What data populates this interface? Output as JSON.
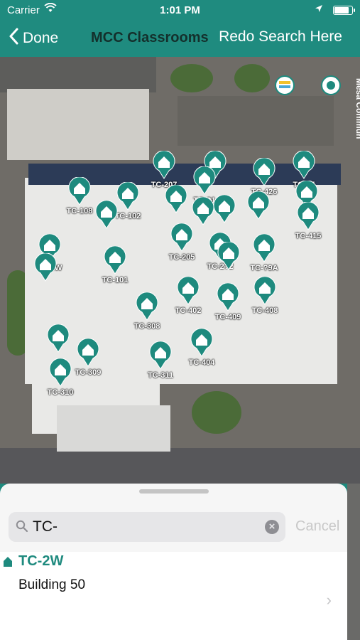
{
  "status": {
    "carrier": "Carrier",
    "time": "1:01 PM"
  },
  "nav": {
    "back_label": "Done",
    "title": "MCC Classrooms",
    "redo_label": "Redo Search Here"
  },
  "map": {
    "road_label": "Mesa Commun",
    "pins": [
      {
        "label": "TC-207"
      },
      {
        "label": ""
      },
      {
        "label": "TC-?1"
      },
      {
        "label": "TC-426"
      },
      {
        "label": "TC-?5"
      },
      {
        "label": "TC-108"
      },
      {
        "label": "TC-102"
      },
      {
        "label": ""
      },
      {
        "label": ""
      },
      {
        "label": ""
      },
      {
        "label": ""
      },
      {
        "label": ""
      },
      {
        "label": ""
      },
      {
        "label": "TC-415"
      },
      {
        "label": "TC-3W"
      },
      {
        "label": ""
      },
      {
        "label": "TC-101"
      },
      {
        "label": "TC-205"
      },
      {
        "label": "TC-2?2"
      },
      {
        "label": ""
      },
      {
        "label": "TC-?9A"
      },
      {
        "label": "TC-402"
      },
      {
        "label": "TC-409"
      },
      {
        "label": "TC-408"
      },
      {
        "label": "TC-308"
      },
      {
        "label": ""
      },
      {
        "label": "TC-309"
      },
      {
        "label": "TC-311"
      },
      {
        "label": "TC-404"
      },
      {
        "label": "TC-310"
      }
    ]
  },
  "search": {
    "value": "TC-",
    "cancel_label": "Cancel"
  },
  "results": [
    {
      "title": "TC-2W",
      "subtitle": "Building 50"
    }
  ],
  "colors": {
    "brand": "#1f8b7f",
    "pin": "#1e8a7e",
    "title_text": "#14302c"
  }
}
